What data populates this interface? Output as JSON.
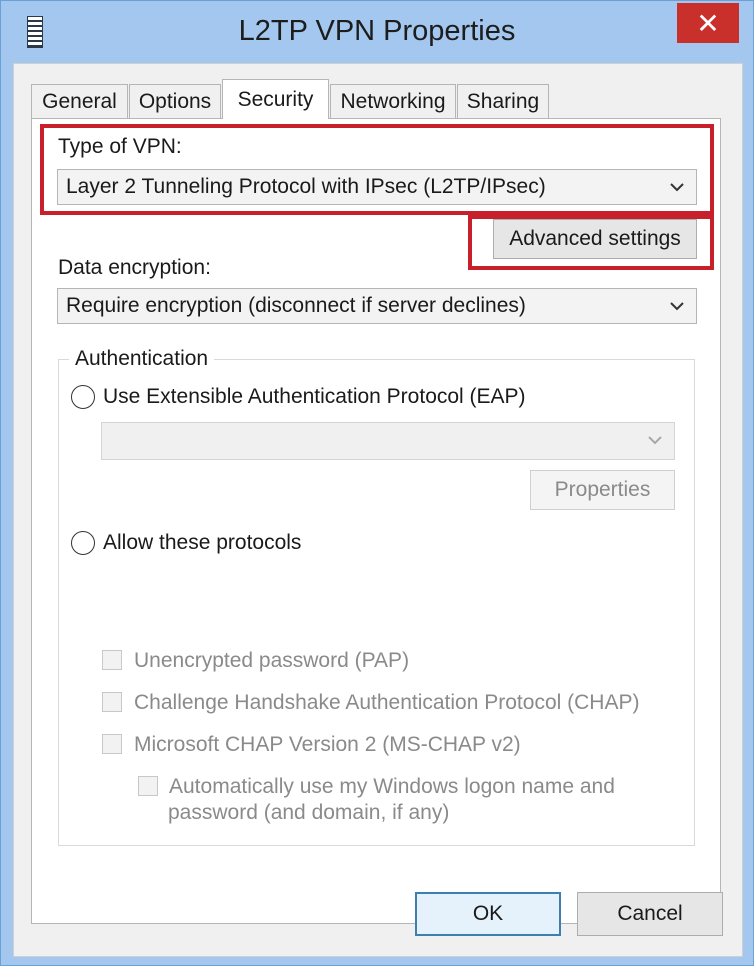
{
  "window": {
    "title": "L2TP VPN Properties",
    "close_glyph": "✕"
  },
  "tabs": [
    {
      "label": "General"
    },
    {
      "label": "Options"
    },
    {
      "label": "Security",
      "selected": true
    },
    {
      "label": "Networking"
    },
    {
      "label": "Sharing"
    }
  ],
  "security": {
    "vpn_type_label": "Type of VPN:",
    "vpn_type_value": "Layer 2 Tunneling Protocol with IPsec (L2TP/IPsec)",
    "advanced_settings_label": "Advanced settings",
    "data_encryption_label": "Data encryption:",
    "data_encryption_value": "Require encryption (disconnect if server declines)",
    "authentication": {
      "group_label": "Authentication",
      "eap_label": "Use Extensible Authentication Protocol (EAP)",
      "eap_selected": false,
      "eap_method_value": "",
      "properties_label": "Properties",
      "allow_protocols_label": "Allow these protocols",
      "allow_protocols_selected": false,
      "protocols": [
        {
          "label": "Unencrypted password (PAP)",
          "checked": false
        },
        {
          "label": "Challenge Handshake Authentication Protocol (CHAP)",
          "checked": false
        },
        {
          "label": "Microsoft CHAP Version 2 (MS-CHAP v2)",
          "checked": false
        }
      ],
      "auto_logon_line1": "Automatically use my Windows logon name and",
      "auto_logon_line2": "password (and domain, if any)",
      "auto_logon_checked": false
    }
  },
  "footer": {
    "ok_label": "OK",
    "cancel_label": "Cancel"
  },
  "colors": {
    "highlight": "#c8202a",
    "titlebar": "#a3c7ee",
    "close": "#c9302c"
  }
}
